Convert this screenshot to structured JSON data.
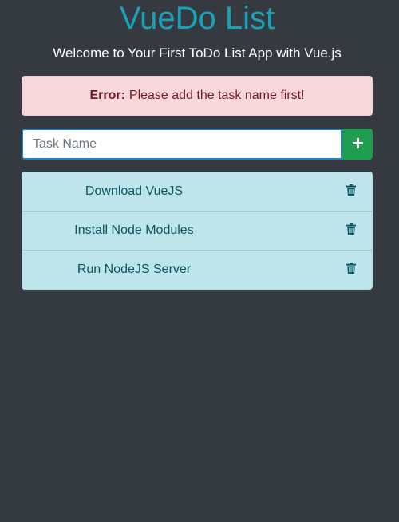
{
  "header": {
    "title": "VueDo List",
    "subtitle": "Welcome to Your First ToDo List App with Vue.js"
  },
  "alert": {
    "prefix": "Error:",
    "message": "Please add the task name first!"
  },
  "input": {
    "placeholder": "Task Name",
    "value": "",
    "add_icon": "plus-icon"
  },
  "tasks": [
    {
      "label": "Download VueJS",
      "icon": "trash-icon"
    },
    {
      "label": "Install Node Modules",
      "icon": "trash-icon"
    },
    {
      "label": "Run NodeJS Server",
      "icon": "trash-icon"
    }
  ],
  "colors": {
    "background": "#343a40",
    "title": "#17a2b8",
    "alert_bg": "#f8d7da",
    "alert_text": "#721c24",
    "add_button": "#1e9e4e",
    "list_bg": "#bee5eb",
    "list_text": "#0c5460"
  }
}
